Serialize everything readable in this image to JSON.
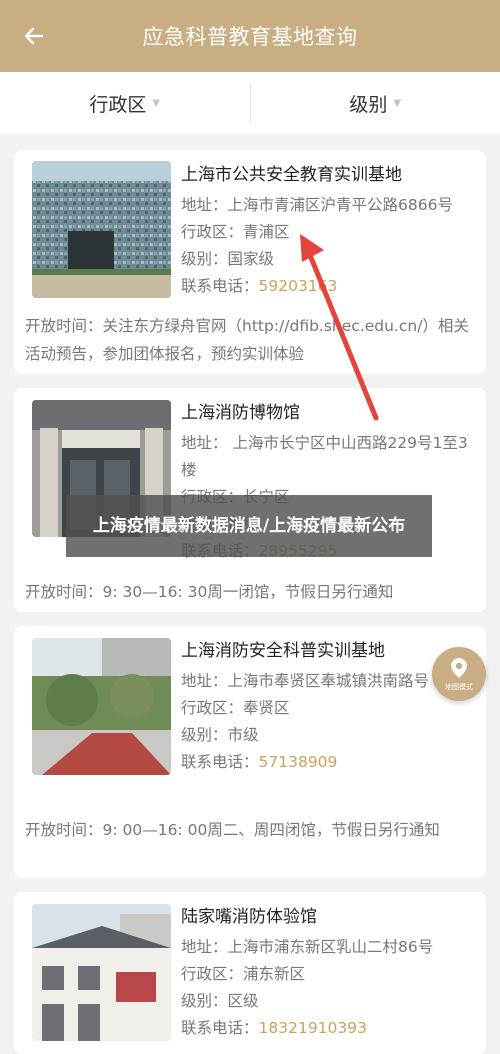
{
  "header": {
    "title": "应急科普教育基地查询",
    "back_icon": "arrow-left-icon"
  },
  "filters": [
    {
      "label": "行政区"
    },
    {
      "label": "级别"
    }
  ],
  "labels": {
    "address": "地址：",
    "district": "行政区：",
    "level": "级别：",
    "phone": "联系电话："
  },
  "items": [
    {
      "name": "上海市公共安全教育实训基地",
      "address": "上海市青浦区沪青平公路6866号",
      "district": "青浦区",
      "level": "国家级",
      "phone": "59203163",
      "hours": "开放时间：关注东方绿舟官网（http://dfib.shec.edu.cn/）相关活动预告，参加团体报名，预约实训体验"
    },
    {
      "name": "上海消防博物馆",
      "address": " 上海市长宁区中山西路229号1至3楼",
      "district": "长宁区",
      "level": "市级",
      "phone": "28955295",
      "hours": "开放时间：9: 30—16: 30周一闭馆，节假日另行通知"
    },
    {
      "name": "上海消防安全科普实训基地",
      "address": "上海市奉贤区奉城镇洪南路号",
      "district": "奉贤区",
      "level": "市级",
      "phone": "57138909",
      "hours": "开放时间：9: 00—16: 00周二、周四闭馆，节假日另行通知"
    },
    {
      "name": "陆家嘴消防体验馆",
      "address": "上海市浦东新区乳山二村86号",
      "district": "浦东新区",
      "level": "区级",
      "phone": "18321910393"
    }
  ],
  "watermark": "上海疫情最新数据消息/上海疫情最新公布",
  "map_mode": {
    "label": "地图模式",
    "icon": "map-pin-icon"
  },
  "colors": {
    "brand": "#c9ae83",
    "phone": "#c9a45d",
    "arrow": "#e5443a"
  }
}
